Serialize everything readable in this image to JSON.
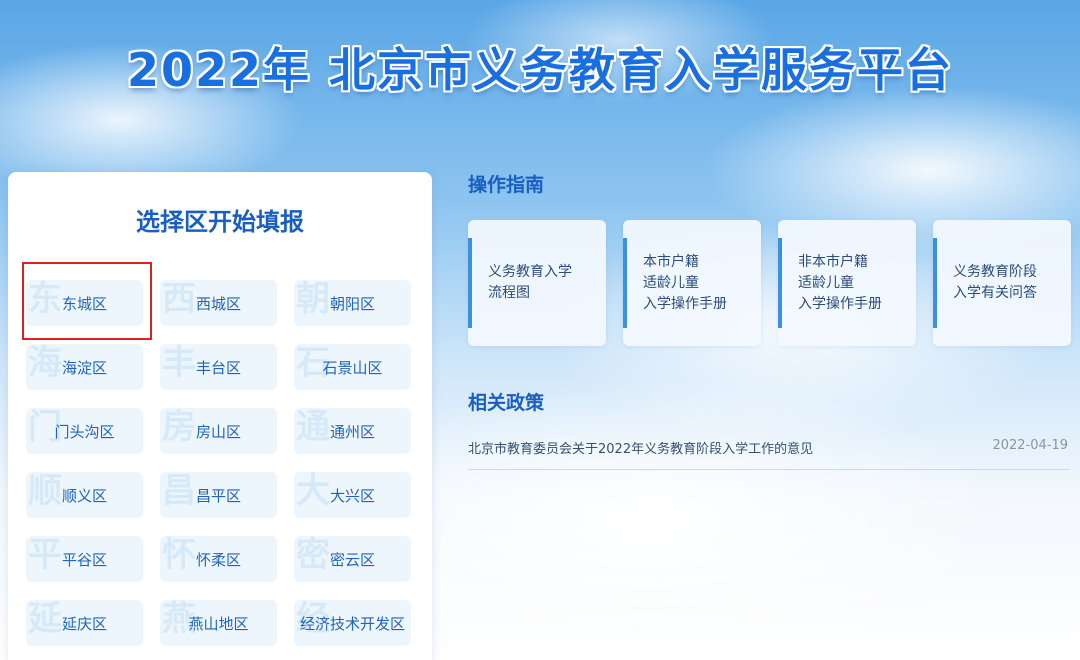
{
  "title": "2022年 北京市义务教育入学服务平台",
  "district_panel": {
    "title": "选择区开始填报",
    "selected": "东城区",
    "districts": [
      {
        "name": "东城区",
        "wm": "东"
      },
      {
        "name": "西城区",
        "wm": "西"
      },
      {
        "name": "朝阳区",
        "wm": "朝"
      },
      {
        "name": "海淀区",
        "wm": "海"
      },
      {
        "name": "丰台区",
        "wm": "丰"
      },
      {
        "name": "石景山区",
        "wm": "石"
      },
      {
        "name": "门头沟区",
        "wm": "门"
      },
      {
        "name": "房山区",
        "wm": "房"
      },
      {
        "name": "通州区",
        "wm": "通"
      },
      {
        "name": "顺义区",
        "wm": "顺"
      },
      {
        "name": "昌平区",
        "wm": "昌"
      },
      {
        "name": "大兴区",
        "wm": "大"
      },
      {
        "name": "平谷区",
        "wm": "平"
      },
      {
        "name": "怀柔区",
        "wm": "怀"
      },
      {
        "name": "密云区",
        "wm": "密"
      },
      {
        "name": "延庆区",
        "wm": "延"
      },
      {
        "name": "燕山地区",
        "wm": "燕"
      },
      {
        "name": "经济技术开发区",
        "wm": "经"
      }
    ]
  },
  "guide": {
    "title": "操作指南",
    "cards": [
      {
        "lines": [
          "义务教育入学",
          "流程图"
        ]
      },
      {
        "lines": [
          "本市户籍",
          "适龄儿童",
          "入学操作手册"
        ]
      },
      {
        "lines": [
          "非本市户籍",
          "适龄儿童",
          "入学操作手册"
        ]
      },
      {
        "lines": [
          "义务教育阶段",
          "入学有关问答"
        ]
      }
    ]
  },
  "policy": {
    "title": "相关政策",
    "items": [
      {
        "title": "北京市教育委员会关于2022年义务教育阶段入学工作的意见",
        "date": "2022-04-19"
      }
    ]
  },
  "colors": {
    "accent": "#1a6fe0",
    "section_title": "#1a5fc0",
    "selected_border": "#e02020"
  }
}
